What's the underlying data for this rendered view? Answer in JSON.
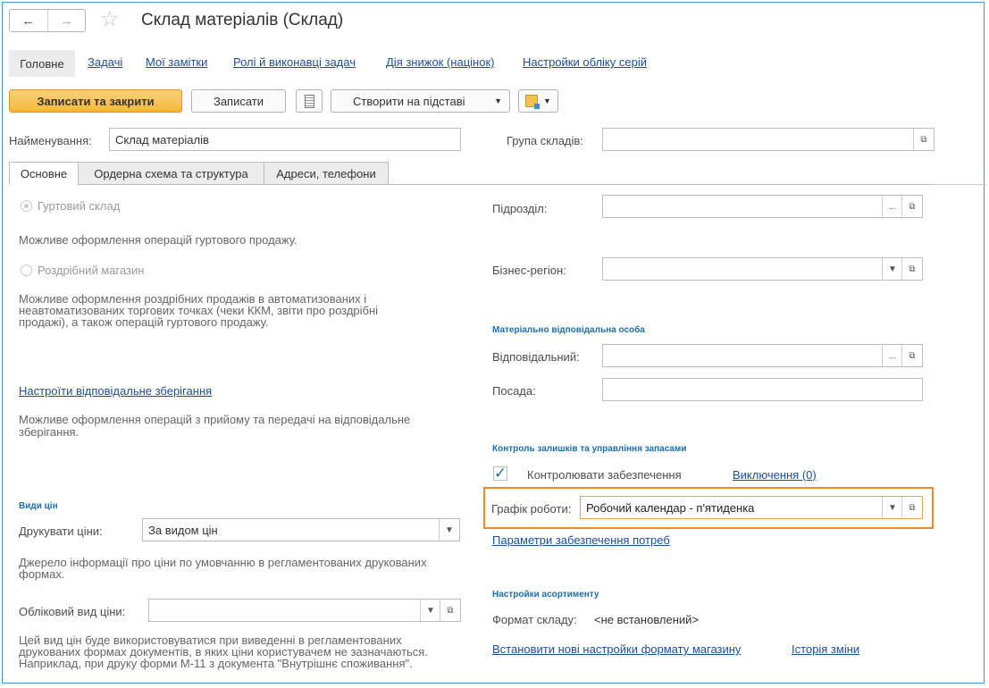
{
  "window": {
    "title": "Склад матеріалів (Склад)"
  },
  "nav": {
    "back_icon": "arrow-left-icon",
    "forward_icon": "arrow-right-icon",
    "favorite_icon": "star-icon",
    "active": "Головне",
    "links": [
      "Задачі",
      "Мої замітки",
      "Ролі й виконавці задач",
      "Дія знижок (націнок)",
      "Настройки обліку серій"
    ]
  },
  "toolbar": {
    "save_close": "Записати та закрити",
    "save": "Записати",
    "create_based": "Створити на підставі"
  },
  "header": {
    "name_label": "Найменування:",
    "name_value": "Склад матеріалів",
    "group_label": "Група складів:",
    "group_value": ""
  },
  "tabs": [
    "Основне",
    "Ордерна схема та структура",
    "Адреси, телефони"
  ],
  "main": {
    "wholesale_label": "Гуртовий склад",
    "wholesale_desc": "Можливе оформлення операцій гуртового продажу.",
    "retail_label": "Роздрібний магазин",
    "retail_desc_1": "Можливе оформлення роздрібних продажів в автоматизованих і",
    "retail_desc_2": "неавтоматизованих торгових точках (чеки ККМ, звіти про роздрібні",
    "retail_desc_3": "продажі), а також операцій гуртового продажу.",
    "custody_link": "Настроїти відповідальне зберігання",
    "custody_desc_1": "Можливе оформлення операцій з прийому та передачі на відповідальне",
    "custody_desc_2": "зберігання.",
    "price_section": "Види цін",
    "print_prices_label": "Друкувати ціни:",
    "print_prices_value": "За видом цін",
    "print_prices_desc_1": "Джерело інформації про ціни по умовчанню в регламентованих друкованих",
    "print_prices_desc_2": "формах.",
    "account_price_label": "Обліковий вид ціни:",
    "account_price_value": "",
    "account_price_desc_1": "Цей вид цін буде використовуватися при виведенні в регламентованих",
    "account_price_desc_2": "друкованих формах документів, в яких ціни користувачем не зазначаються.",
    "account_price_desc_3": "Наприклад, при друку форми М-11 з документа \"Внутрішнє споживання\"."
  },
  "right": {
    "division_label": "Підрозділ:",
    "division_value": "",
    "region_label": "Бізнес-регіон:",
    "region_value": "",
    "responsible_section": "Матеріально відповідальна особа",
    "responsible_label": "Відповідальний:",
    "responsible_value": "",
    "position_label": "Посада:",
    "position_value": "",
    "stock_section": "Контроль залишків та управління запасами",
    "control_label": "Контролювати забезпечення",
    "exceptions_link": "Виключення (0)",
    "schedule_label": "Графік роботи:",
    "schedule_value": "Робочий календар - п'ятиденка",
    "supply_params_link": "Параметри забезпечення потреб",
    "assortment_section": "Настройки асортименту",
    "store_format_label": "Формат складу:",
    "store_format_value": "<не встановлений>",
    "new_format_link": "Встановити нові настройки формату магазину",
    "history_link": "Історія зміни"
  },
  "colors": {
    "accent": "#f5b73a",
    "highlight": "#f08a24",
    "link": "#1c4fa0",
    "section": "#1a6fb3"
  }
}
